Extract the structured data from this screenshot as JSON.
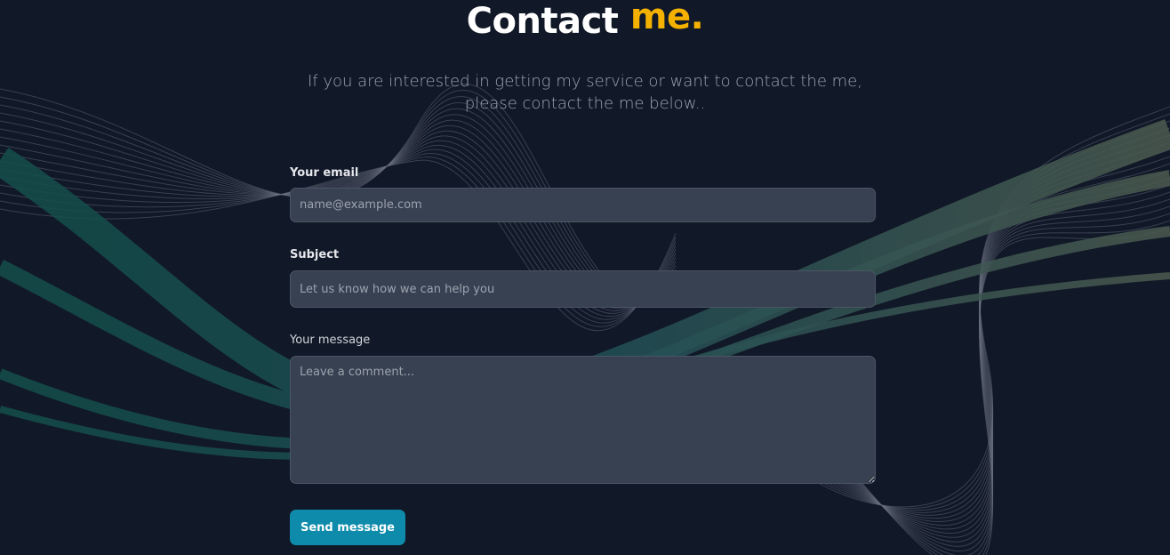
{
  "header": {
    "title_main": "Contact",
    "title_accent": "me.",
    "subtitle_line1": "If you are interested in getting my service or want to contact the me,",
    "subtitle_line2": "please contact the me below.."
  },
  "form": {
    "email": {
      "label": "Your email",
      "placeholder": "name@example.com",
      "value": ""
    },
    "subject": {
      "label": "Subject",
      "placeholder": "Let us know how we can help you",
      "value": ""
    },
    "message": {
      "label": "Your message",
      "placeholder": "Leave a comment...",
      "value": ""
    },
    "submit_label": "Send message"
  },
  "colors": {
    "background": "#111827",
    "accent": "#f5b100",
    "button": "#0e8bab",
    "input_bg": "#374151"
  }
}
